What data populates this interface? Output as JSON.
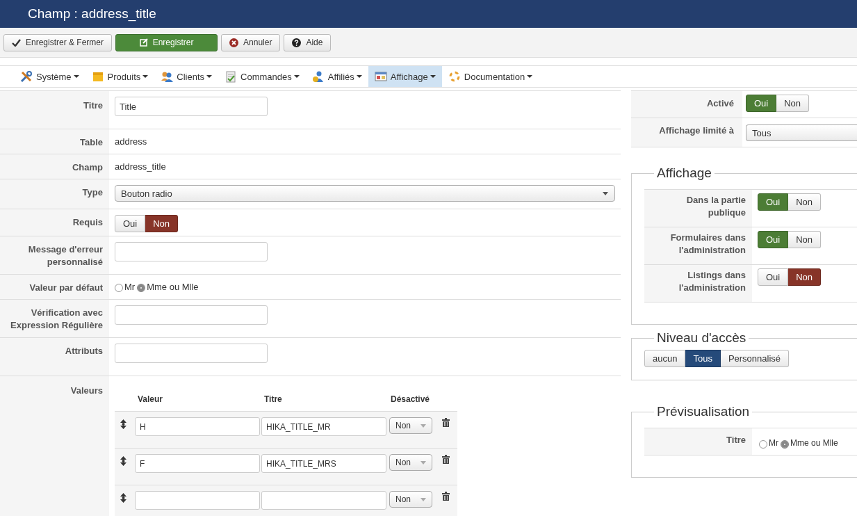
{
  "header": {
    "title": "Champ : address_title"
  },
  "toolbar": [
    {
      "kind": "save-close",
      "label": "Enregistrer & Fermer"
    },
    {
      "kind": "save",
      "label": "Enregistrer"
    },
    {
      "kind": "cancel",
      "label": "Annuler"
    },
    {
      "kind": "help",
      "label": "Aide"
    }
  ],
  "menu": [
    {
      "label": "Système",
      "selected": false
    },
    {
      "label": "Produits",
      "selected": false
    },
    {
      "label": "Clients",
      "selected": false
    },
    {
      "label": "Commandes",
      "selected": false
    },
    {
      "label": "Affiliés",
      "selected": false
    },
    {
      "label": "Affichage",
      "selected": true
    },
    {
      "label": "Documentation",
      "selected": false
    }
  ],
  "form": [
    {
      "kind": "input",
      "label": "Titre",
      "value": "Title"
    },
    {
      "kind": "text",
      "label": "Table",
      "value": "address"
    },
    {
      "kind": "text",
      "label": "Champ",
      "value": "address_title"
    },
    {
      "kind": "select",
      "label": "Type",
      "value": "Bouton radio"
    },
    {
      "kind": "toggle",
      "label": "Requis",
      "options": [
        {
          "label": "Oui",
          "selected": false
        },
        {
          "label": "Non",
          "selected": true
        }
      ]
    },
    {
      "kind": "input",
      "label": "Message d'erreur personnalisé"
    },
    {
      "kind": "radio",
      "label": "Valeur par défaut",
      "options": [
        {
          "label": "Mr",
          "selected": false
        },
        {
          "label": "Mme ou Mlle",
          "selected": true
        }
      ]
    },
    {
      "kind": "input",
      "label": "Vérification avec Expression Régulière"
    },
    {
      "kind": "input",
      "label": "Attributs"
    },
    {
      "kind": "values",
      "label": "Valeurs",
      "columns": [
        "Valeur",
        "Titre",
        "Désactivé"
      ],
      "rows": [
        {
          "value": "H",
          "title": "HIKA_TITLE_MR",
          "disabled": "Non"
        },
        {
          "value": "F",
          "title": "HIKA_TITLE_MRS",
          "disabled": "Non"
        },
        {
          "disabled": "Non"
        }
      ]
    }
  ],
  "settings": [
    {
      "kind": "toggle",
      "label": "Activé",
      "options": [
        {
          "label": "Oui",
          "selected": true
        },
        {
          "label": "Non",
          "selected": false
        }
      ]
    },
    {
      "kind": "select",
      "label": "Affichage limité à",
      "value": "Tous"
    }
  ],
  "display": {
    "legend": "Affichage",
    "rows": [
      {
        "label": "Dans la partie publique",
        "options": [
          {
            "label": "Oui",
            "selected": true
          },
          {
            "label": "Non",
            "selected": false
          }
        ]
      },
      {
        "label": "Formulaires dans l'administration",
        "options": [
          {
            "label": "Oui",
            "selected": true
          },
          {
            "label": "Non",
            "selected": false
          }
        ]
      },
      {
        "label": "Listings dans l'administration",
        "options": [
          {
            "label": "Oui",
            "selected": false
          },
          {
            "label": "Non",
            "selected": true
          }
        ]
      }
    ]
  },
  "access": {
    "legend": "Niveau d'accès",
    "options": [
      {
        "label": "aucun",
        "selected": false
      },
      {
        "label": "Tous",
        "selected": true
      },
      {
        "label": "Personnalisé",
        "selected": false
      }
    ]
  },
  "preview": {
    "legend": "Prévisualisation",
    "label": "Titre",
    "options": [
      {
        "label": "Mr",
        "selected": false
      },
      {
        "label": "Mme ou Mlle",
        "selected": true
      }
    ]
  }
}
